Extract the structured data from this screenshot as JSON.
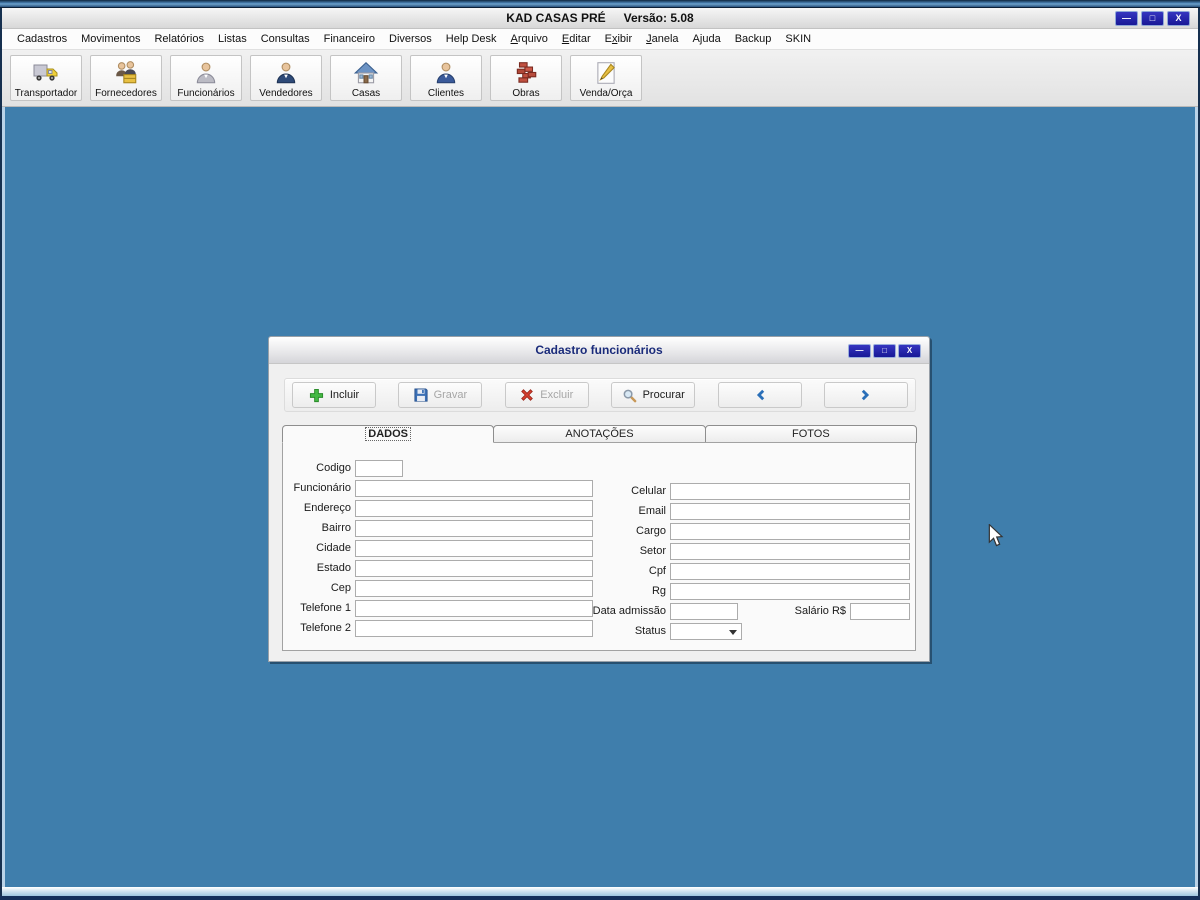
{
  "window": {
    "title": "KAD CASAS PRÉ",
    "version_label": "Versão: 5.08",
    "controls": {
      "minimize": "—",
      "maximize": "□",
      "close": "X"
    }
  },
  "menu": {
    "items": [
      {
        "pre": "Cadastros",
        "key": "",
        "post": ""
      },
      {
        "pre": "Movimentos",
        "key": "",
        "post": ""
      },
      {
        "pre": "Relatórios",
        "key": "",
        "post": ""
      },
      {
        "pre": "Listas",
        "key": "",
        "post": ""
      },
      {
        "pre": "Consultas",
        "key": "",
        "post": ""
      },
      {
        "pre": "Financeiro",
        "key": "",
        "post": ""
      },
      {
        "pre": "Diversos",
        "key": "",
        "post": ""
      },
      {
        "pre": "Help Desk",
        "key": "",
        "post": ""
      },
      {
        "pre": "",
        "key": "A",
        "post": "rquivo"
      },
      {
        "pre": "",
        "key": "E",
        "post": "ditar"
      },
      {
        "pre": "E",
        "key": "x",
        "post": "ibir"
      },
      {
        "pre": "",
        "key": "J",
        "post": "anela"
      },
      {
        "pre": "Ajuda",
        "key": "",
        "post": ""
      },
      {
        "pre": "Backup",
        "key": "",
        "post": ""
      },
      {
        "pre": "SKIN",
        "key": "",
        "post": ""
      }
    ]
  },
  "toolbar": {
    "buttons": [
      {
        "label": "Transportador",
        "icon": "truck-icon"
      },
      {
        "label": "Fornecedores",
        "icon": "suppliers-icon"
      },
      {
        "label": "Funcionários",
        "icon": "employee-icon"
      },
      {
        "label": "Vendedores",
        "icon": "salesperson-icon"
      },
      {
        "label": "Casas",
        "icon": "house-icon"
      },
      {
        "label": "Clientes",
        "icon": "client-icon"
      },
      {
        "label": "Obras",
        "icon": "bricks-icon"
      },
      {
        "label": "Venda/Orça",
        "icon": "pencil-paper-icon"
      }
    ]
  },
  "dialog": {
    "title": "Cadastro funcionários",
    "controls": {
      "minimize": "—",
      "maximize": "□",
      "close": "X"
    },
    "commands": [
      {
        "label": "Incluir",
        "icon": "plus-icon",
        "enabled": true
      },
      {
        "label": "Gravar",
        "icon": "floppy-icon",
        "enabled": false
      },
      {
        "label": "Excluir",
        "icon": "delete-x-icon",
        "enabled": false
      },
      {
        "label": "Procurar",
        "icon": "magnifier-icon",
        "enabled": true
      }
    ],
    "tabs": [
      {
        "label": "DADOS",
        "active": true
      },
      {
        "label": "ANOTAÇÕES",
        "active": false
      },
      {
        "label": "FOTOS",
        "active": false
      }
    ],
    "form": {
      "labels": {
        "codigo": "Codigo",
        "funcionario": "Funcionário",
        "endereco": "Endereço",
        "bairro": "Bairro",
        "cidade": "Cidade",
        "estado": "Estado",
        "cep": "Cep",
        "telefone1": "Telefone 1",
        "telefone2": "Telefone 2",
        "celular": "Celular",
        "email": "Email",
        "cargo": "Cargo",
        "setor": "Setor",
        "cpf": "Cpf",
        "rg": "Rg",
        "data_admissao": "Data admissão",
        "salario": "Salário R$",
        "status": "Status"
      },
      "values": {
        "codigo": "",
        "funcionario": "",
        "endereco": "",
        "bairro": "",
        "cidade": "",
        "estado": "",
        "cep": "",
        "telefone1": "",
        "telefone2": "",
        "celular": "",
        "email": "",
        "cargo": "",
        "setor": "",
        "cpf": "",
        "rg": "",
        "data_admissao": "",
        "salario": "",
        "status": ""
      }
    }
  },
  "colors": {
    "desktop_blue": "#3F7EAC",
    "control_navy": "#181896",
    "dialog_title_text": "#1A2B7A",
    "plus_green": "#44B944",
    "floppy_blue": "#3A6FB5",
    "delete_red": "#D64030",
    "chevron_blue": "#2A6FB8"
  }
}
